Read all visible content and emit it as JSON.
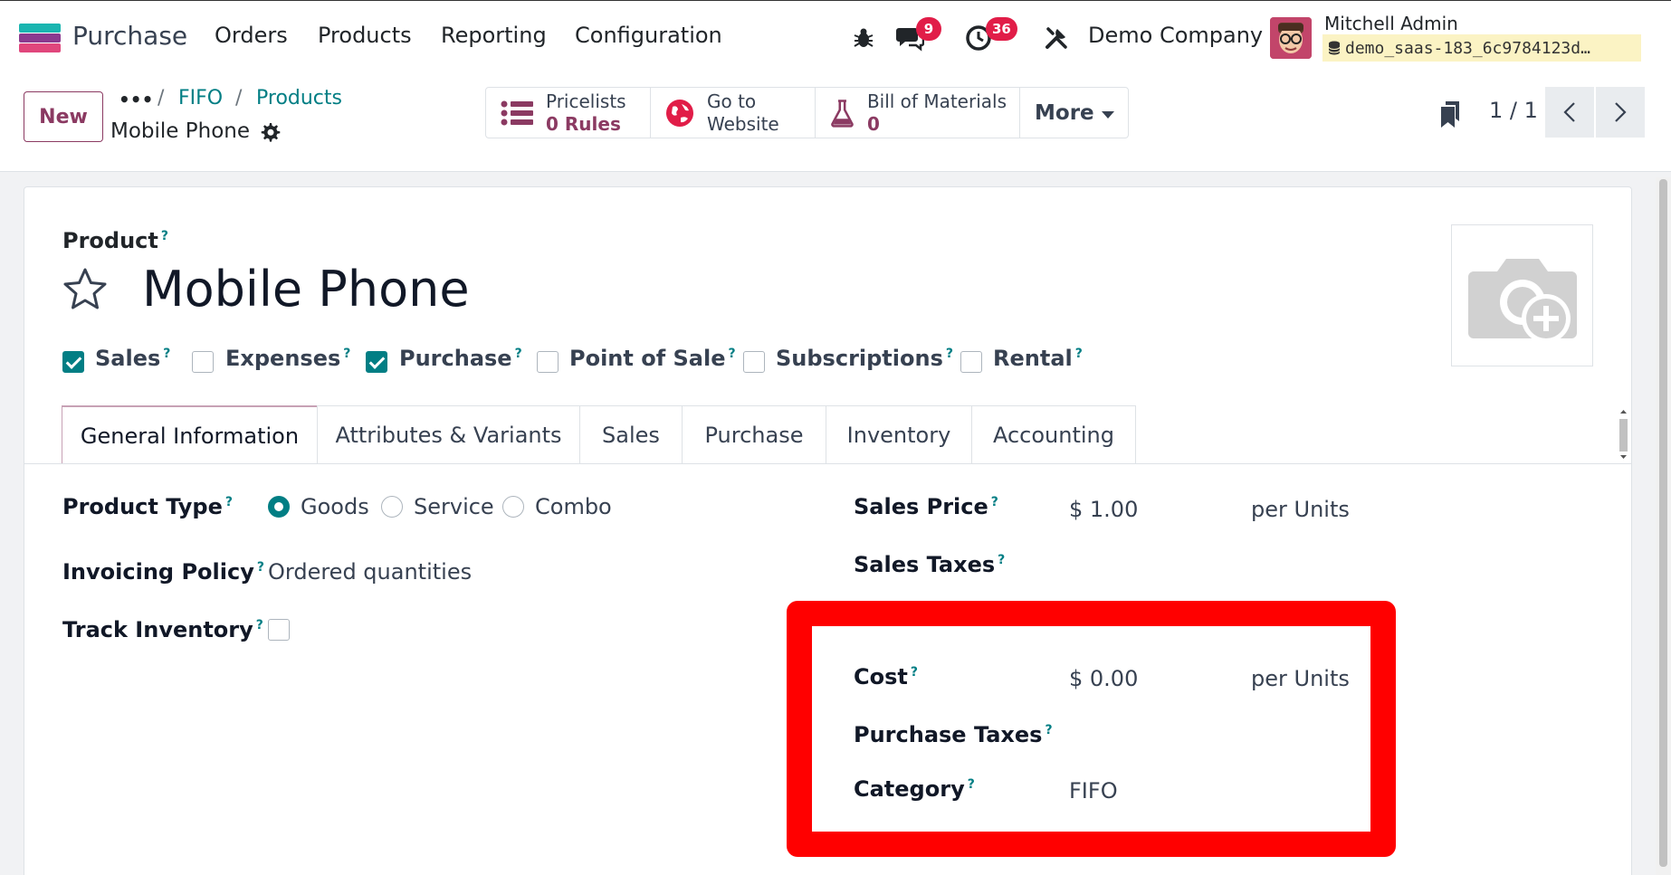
{
  "navbar": {
    "app_name": "Purchase",
    "menus": [
      "Orders",
      "Products",
      "Reporting",
      "Configuration"
    ],
    "messages_count": "9",
    "activities_count": "36",
    "company": "Demo Company",
    "user_name": "Mitchell Admin",
    "database": "demo_saas-183_6c9784123d…"
  },
  "control_panel": {
    "new_label": "New",
    "breadcrumb_more": "•••",
    "breadcrumb": [
      "FIFO",
      "Products"
    ],
    "record_name": "Mobile Phone",
    "smart_buttons": [
      {
        "title": "Pricelists",
        "value": "0 Rules"
      },
      {
        "title": "Go to",
        "value": "Website"
      },
      {
        "title": "Bill of Materials",
        "value": "0"
      }
    ],
    "more_label": "More",
    "pager": "1 / 1"
  },
  "form": {
    "product_label": "Product",
    "help_mark": "?",
    "product_name": "Mobile Phone",
    "checkboxes": [
      {
        "label": "Sales",
        "checked": true
      },
      {
        "label": "Expenses",
        "checked": false
      },
      {
        "label": "Purchase",
        "checked": true
      },
      {
        "label": "Point of Sale",
        "checked": false
      },
      {
        "label": "Subscriptions",
        "checked": false
      },
      {
        "label": "Rental",
        "checked": false
      }
    ],
    "tabs": [
      "General Information",
      "Attributes & Variants",
      "Sales",
      "Purchase",
      "Inventory",
      "Accounting"
    ],
    "product_type_label": "Product Type",
    "product_type_options": [
      "Goods",
      "Service",
      "Combo"
    ],
    "product_type_selected": "Goods",
    "invoicing_policy_label": "Invoicing Policy",
    "invoicing_policy_value": "Ordered quantities",
    "track_inventory_label": "Track Inventory",
    "track_inventory_checked": false,
    "sales_price_label": "Sales Price",
    "sales_price_value": "$ 1.00",
    "sales_price_unit": "per Units",
    "sales_taxes_label": "Sales Taxes",
    "cost_label": "Cost",
    "cost_value": "$ 0.00",
    "cost_unit": "per Units",
    "purchase_taxes_label": "Purchase Taxes",
    "category_label": "Category",
    "category_value": "FIFO"
  },
  "colors": {
    "brand": "#8b3a62",
    "accent": "#017e84",
    "highlight": "#ff0000",
    "badge": "#e11d48"
  }
}
